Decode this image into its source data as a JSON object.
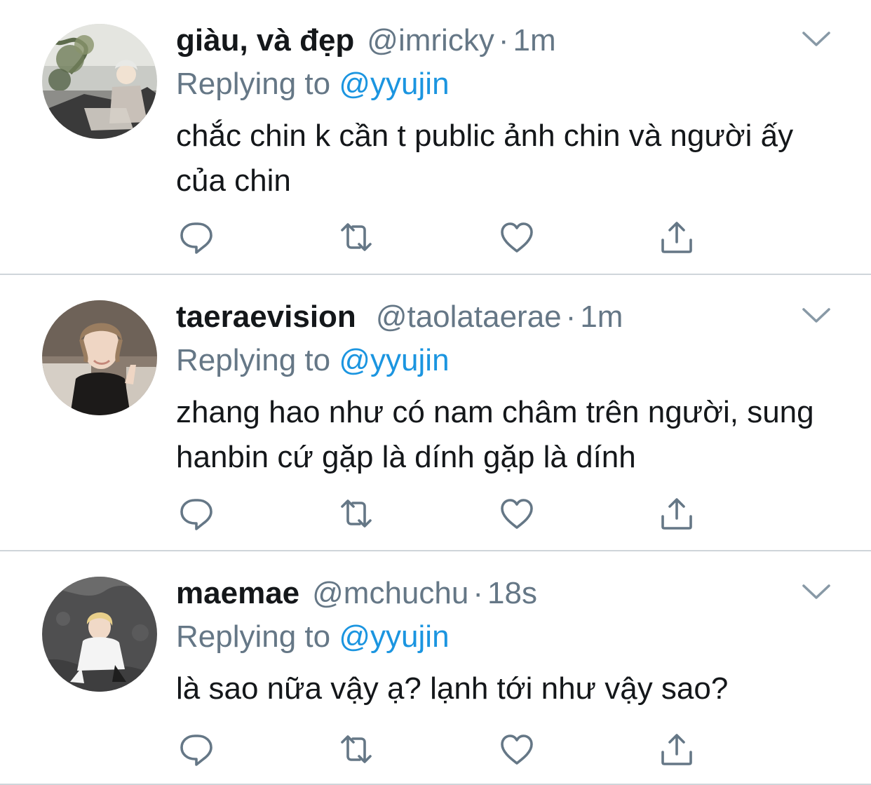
{
  "colors": {
    "text": "#14171a",
    "secondary": "#657786",
    "link": "#1b95e0",
    "divider": "#cfd5da"
  },
  "tweets": [
    {
      "display_name": "giàu, và đẹp",
      "handle": "@imricky",
      "separator": "·",
      "time": "1m",
      "replying_label": "Replying to",
      "replying_to": "@yyujin",
      "text": "chắc chin k cần t public ảnh chin và người ấy của chin",
      "icons": [
        "reply-icon",
        "retweet-icon",
        "like-icon",
        "share-icon",
        "chevron-down-icon"
      ]
    },
    {
      "display_name": "taeraevision",
      "handle": "@taolataerae",
      "separator": "·",
      "time": "1m",
      "replying_label": "Replying to",
      "replying_to": "@yyujin",
      "text": "zhang hao như có nam châm trên người, sung hanbin cứ gặp là dính gặp là dính",
      "icons": [
        "reply-icon",
        "retweet-icon",
        "like-icon",
        "share-icon",
        "chevron-down-icon"
      ]
    },
    {
      "display_name": "maemae",
      "handle": "@mchuchu",
      "separator": "·",
      "time": "18s",
      "replying_label": "Replying to",
      "replying_to": "@yyujin",
      "text": "là sao nữa vậy ạ? lạnh tới như vậy sao?",
      "icons": [
        "reply-icon",
        "retweet-icon",
        "like-icon",
        "share-icon",
        "chevron-down-icon"
      ]
    }
  ]
}
